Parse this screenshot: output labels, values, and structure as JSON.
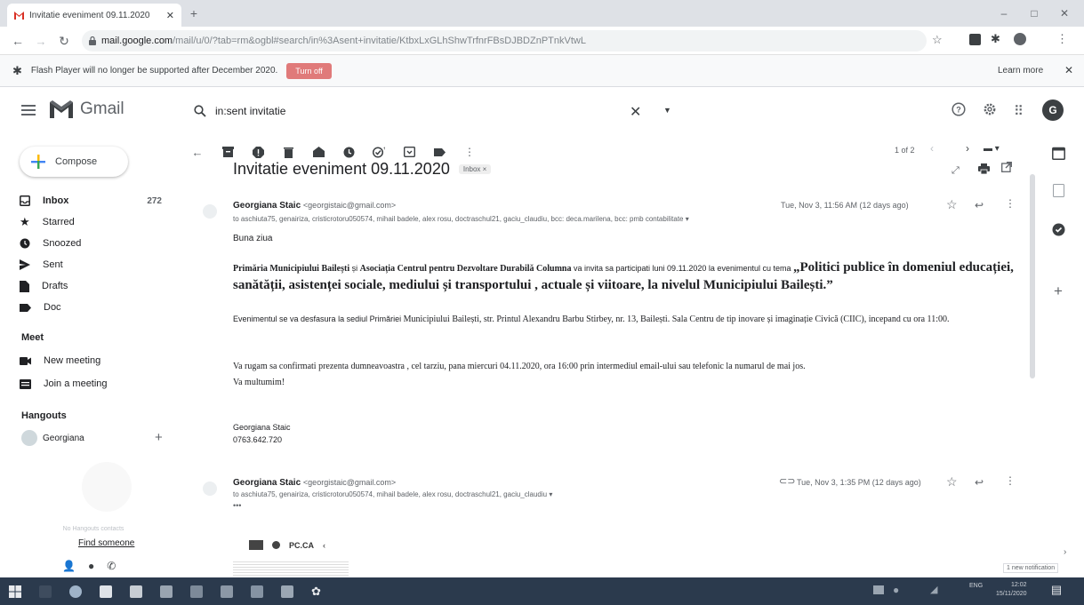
{
  "browser": {
    "tab_title": "Invitatie eveniment 09.11.2020",
    "url_host": "mail.google.com",
    "url_path": "/mail/u/0/?tab=rm&ogbl#search/in%3Asent+invitatie/KtbxLxGLhShwTrfnrFBsDJBDZnPTnkVtwL"
  },
  "infobar": {
    "message": "Flash Player will no longer be supported after December 2020.",
    "turn_off": "Turn off",
    "learn_more": "Learn more"
  },
  "gmail": {
    "logo_word": "Gmail",
    "search_value": "in:sent invitatie",
    "avatar_letter": "G"
  },
  "sidebar": {
    "compose": "Compose",
    "items": [
      {
        "label": "Inbox",
        "count": "272"
      },
      {
        "label": "Starred",
        "count": ""
      },
      {
        "label": "Snoozed",
        "count": ""
      },
      {
        "label": "Sent",
        "count": ""
      },
      {
        "label": "Drafts",
        "count": ""
      },
      {
        "label": "Doc",
        "count": ""
      }
    ],
    "meet_title": "Meet",
    "meet_items": [
      "New meeting",
      "Join a meeting"
    ],
    "hangouts_title": "Hangouts",
    "hangouts_user": "Georgiana",
    "hangouts_empty": "No Hangouts contacts",
    "find_someone": "Find someone"
  },
  "toolbar": {
    "pager": "1 of 2"
  },
  "thread": {
    "subject": "Invitatie eveniment 09.11.2020",
    "label": "Inbox ×",
    "messages": [
      {
        "from_name": "Georgiana Staic",
        "from_email": "<georgistaic@gmail.com>",
        "date": "Tue, Nov 3, 11:56 AM (12 days ago)",
        "to": "to aschiuta75, genairiza, cristicrotoru050574, mihail badele, alex rosu, doctraschul21, gaciu_claudiu, bcc: deca.marilena, bcc: pmb contabilitate ▾"
      },
      {
        "from_name": "Georgiana Staic",
        "from_email": "<georgistaic@gmail.com>",
        "date": "Tue, Nov 3, 1:35 PM (12 days ago)",
        "to": "to aschiuta75, genairiza, cristicrotoru050574, mihail badele, alex rosu, doctraschul21, gaciu_claudiu ▾",
        "collapsed": "•••"
      }
    ],
    "body": {
      "greeting": "Buna ziua",
      "p1_org1": "Primăria Municipiului Bailești",
      "p1_and": " și ",
      "p1_org2": "Asociația Centrul pentru Dezvoltare Durabilă Columna",
      "p1_mid": " va invita sa participati luni 09.11.2020 la evenimentul cu tema ",
      "p1_theme": "„Politici publice în domeniul educației, sanătății, asistenței sociale, mediului și transportului , actuale și viitoare, la nivelul Municipiului Bailești.”",
      "p2_sans": "Evenimentul se va desfasura la sediul Primăriei ",
      "p2_serif": "Municipiului Bailești, str. Printul Alexandru Barbu Stirbey, nr. 13, Bailești.  Sala Centru de tip inovare și imaginație Civică (CIIC), incepand cu ora 11:00.",
      "p3_line1": "Va rugam sa confirmati prezenta dumneavoastra , cel tarziu, pana miercuri 04.11.2020, ora 16:00 prin intermediul email-ului sau telefonic la numarul de mai jos.",
      "p3_line2": "Va multumim!",
      "sig_name": "Georgiana Staic",
      "sig_phone": "0763.642.720"
    },
    "logo_text": "PC.CA"
  },
  "notification": "1 new notification",
  "taskbar": {
    "lang": "ENG",
    "time": "12:02",
    "date": "15/11/2020"
  }
}
